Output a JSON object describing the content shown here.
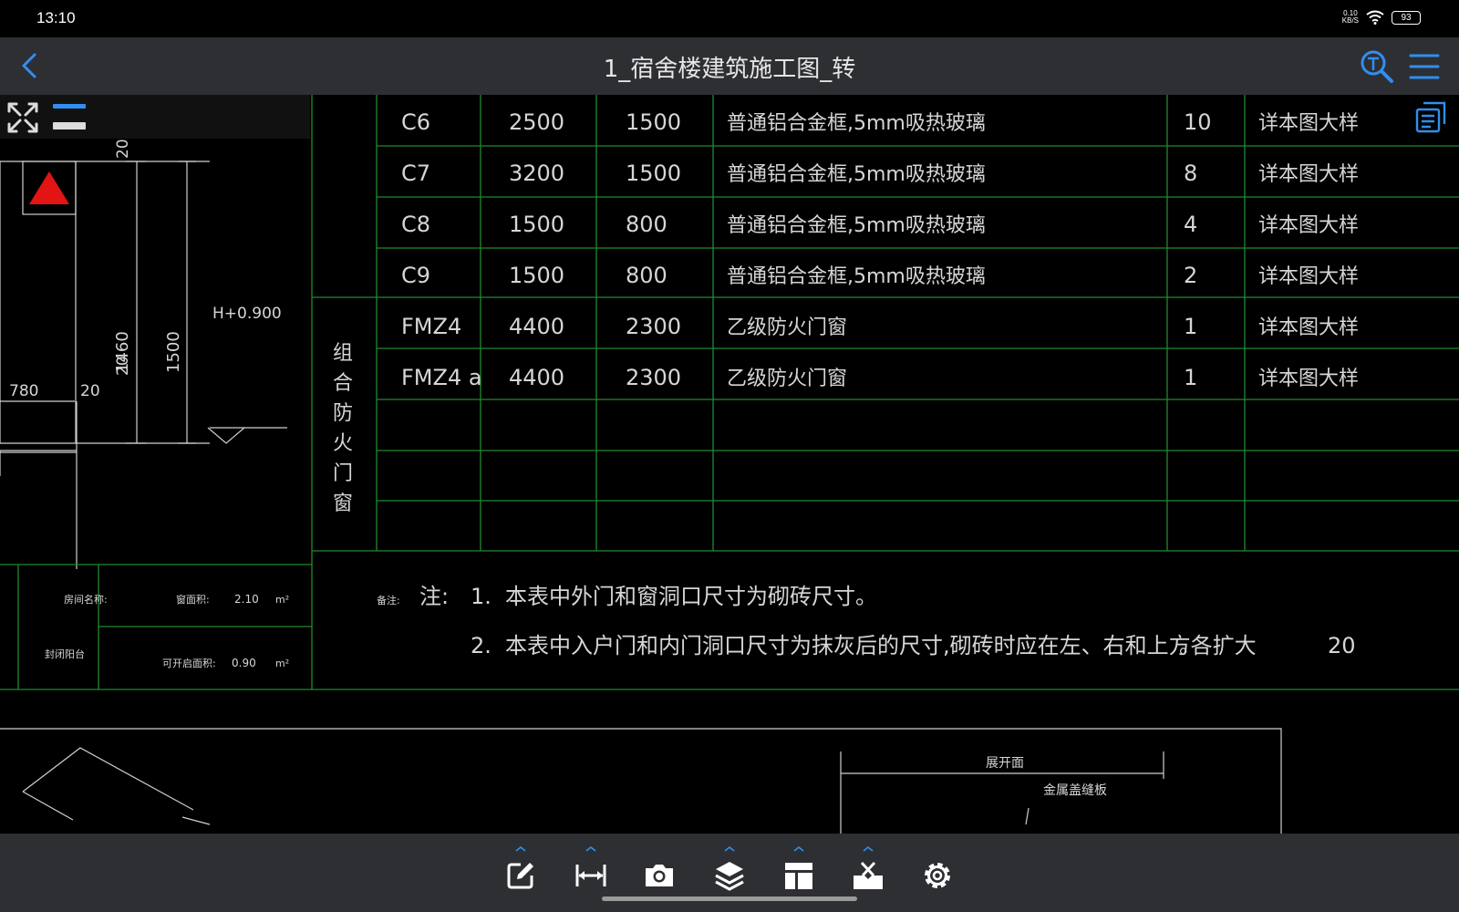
{
  "status": {
    "time": "13:10",
    "netspeed_value": "0.10",
    "netspeed_unit": "KB/S",
    "battery": "93"
  },
  "header": {
    "title": "1_宿舍楼建筑施工图_转"
  },
  "drawing": {
    "window_table": {
      "group_label": "组合防火门窗",
      "rows": [
        {
          "code": "C6",
          "width": "2500",
          "height": "1500",
          "desc": "普通铝合金框,5mm吸热玻璃",
          "qty": "10",
          "note": "详本图大样"
        },
        {
          "code": "C7",
          "width": "3200",
          "height": "1500",
          "desc": "普通铝合金框,5mm吸热玻璃",
          "qty": "8",
          "note": "详本图大样"
        },
        {
          "code": "C8",
          "width": "1500",
          "height": "800",
          "desc": "普通铝合金框,5mm吸热玻璃",
          "qty": "4",
          "note": "详本图大样"
        },
        {
          "code": "C9",
          "width": "1500",
          "height": "800",
          "desc": "普通铝合金框,5mm吸热玻璃",
          "qty": "2",
          "note": "详本图大样"
        },
        {
          "code": "FMZ4",
          "width": "4400",
          "height": "2300",
          "desc": "乙级防火门窗",
          "qty": "1",
          "note": "详本图大样"
        },
        {
          "code": "FMZ4 a",
          "width": "4400",
          "height": "2300",
          "desc": "乙级防火门窗",
          "qty": "1",
          "note": "详本图大样"
        }
      ]
    },
    "notes": {
      "remark_label": "备注:",
      "note_label": "注:",
      "note1_num": "1.",
      "note1": "本表中外门和窗洞口尺寸为砌砖尺寸。",
      "note2_num": "2.",
      "note2": "本表中入户门和内门洞口尺寸为抹灰后的尺寸,砌砖时应在左、右和上方各扩大",
      "note2_dot": "。",
      "note2_value": "20"
    },
    "left_detail": {
      "dim_20_top": "20",
      "dim_1460": "1460",
      "dim_1500": "1500",
      "elevation": "H+0.900",
      "dim_20_bottom": "20",
      "dim_780": "780",
      "dim_20_side": "20",
      "room_name_label": "房间名称:",
      "window_area_label": "窗面积:",
      "window_area_value": "2.10",
      "area_unit_1": "m²",
      "room_name_value": "封闭阳台",
      "openable_area_label": "可开启面积:",
      "openable_area_value": "0.90",
      "area_unit_2": "m²"
    },
    "lower_detail": {
      "label_1": "展开面",
      "label_2": "金属盖缝板"
    }
  },
  "colors": {
    "accent": "#2f8ff0",
    "grid": "#1f8a2e",
    "cad_text": "#d6d6d6",
    "marker": "#e31414"
  }
}
